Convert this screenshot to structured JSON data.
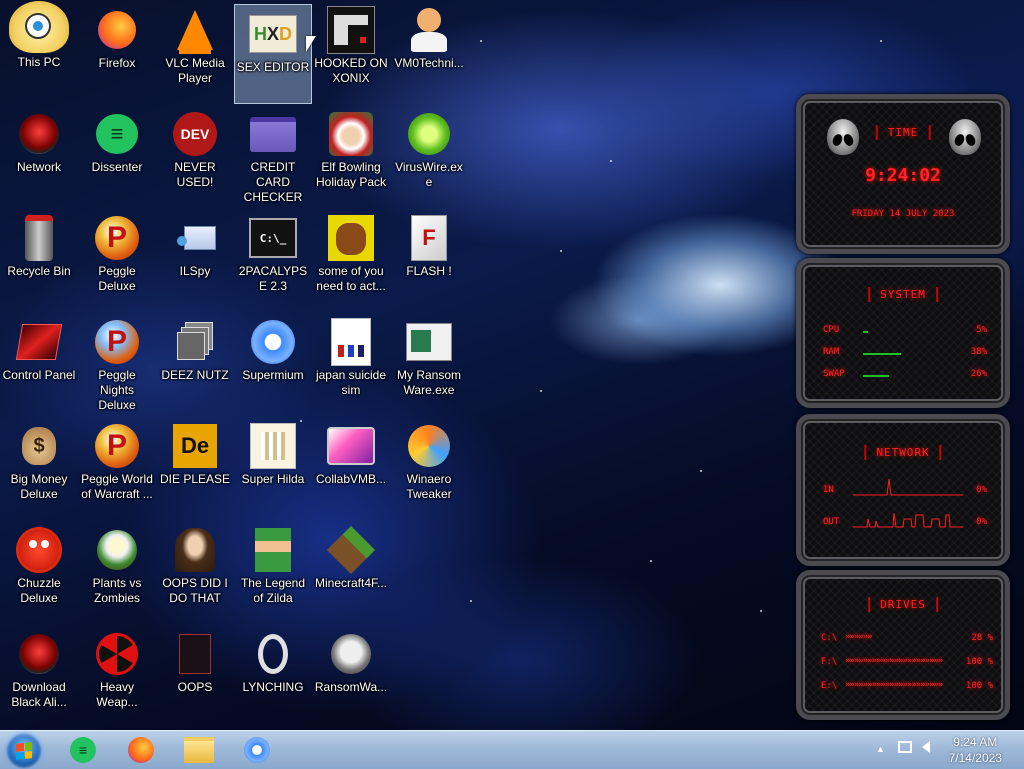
{
  "desktop": {
    "icons": [
      {
        "label": "This PC"
      },
      {
        "label": "Firefox"
      },
      {
        "label": "VLC Media Player"
      },
      {
        "label": "SEX EDITOR"
      },
      {
        "label": "HOOKED ON XONIX"
      },
      {
        "label": "VM0Techni..."
      },
      {
        "label": "Network"
      },
      {
        "label": "Dissenter"
      },
      {
        "label": "NEVER USED!"
      },
      {
        "label": "CREDIT CARD CHECKER"
      },
      {
        "label": "Elf Bowling Holiday Pack"
      },
      {
        "label": "VirusWire.exe"
      },
      {
        "label": "Recycle Bin"
      },
      {
        "label": "Peggle Deluxe"
      },
      {
        "label": "ILSpy"
      },
      {
        "label": "2PACALYPSE 2.3"
      },
      {
        "label": "some of you need to act..."
      },
      {
        "label": "FLASH !"
      },
      {
        "label": "Control Panel"
      },
      {
        "label": "Peggle Nights Deluxe"
      },
      {
        "label": "DEEZ NUTZ"
      },
      {
        "label": "Supermium"
      },
      {
        "label": "japan suicide sim"
      },
      {
        "label": "My Ransom Ware.exe"
      },
      {
        "label": "Big Money Deluxe"
      },
      {
        "label": "Peggle World of Warcraft ..."
      },
      {
        "label": "DIE PLEASE"
      },
      {
        "label": "Super Hilda"
      },
      {
        "label": "CollabVMB..."
      },
      {
        "label": "Winaero Tweaker"
      },
      {
        "label": "Chuzzle Deluxe"
      },
      {
        "label": "Plants vs Zombies"
      },
      {
        "label": "OOPS DID I DO THAT"
      },
      {
        "label": "The Legend of Zilda"
      },
      {
        "label": "Minecraft4F..."
      },
      {
        "label": "Download Black Ali..."
      },
      {
        "label": "Heavy Weap..."
      },
      {
        "label": "OOPS"
      },
      {
        "label": "LYNCHING"
      },
      {
        "label": "RansomWa..."
      }
    ],
    "icon_glyphs": {
      "vlc": "▲",
      "dev": "DEV",
      "dissenter": "≡",
      "cmd": "C:\\_",
      "de": "De",
      "flash": "F",
      "peggle": "P"
    }
  },
  "widgets": {
    "time": {
      "title": "TIME",
      "clock": "9:24:02",
      "date": "FRIDAY 14 JULY 2023"
    },
    "system": {
      "title": "SYSTEM",
      "rows": [
        {
          "label": "CPU",
          "value": "5%",
          "level": 0.05
        },
        {
          "label": "RAM",
          "value": "38%",
          "level": 0.38
        },
        {
          "label": "SWAP",
          "value": "26%",
          "level": 0.26
        }
      ]
    },
    "network": {
      "title": "NETWORK",
      "rows": [
        {
          "label": "IN",
          "value": "0%"
        },
        {
          "label": "OUT",
          "value": "0%"
        }
      ]
    },
    "drives": {
      "title": "DRIVES",
      "rows": [
        {
          "label": "C:\\",
          "value": "28 %",
          "level": 0.28
        },
        {
          "label": "F:\\",
          "value": "100 %",
          "level": 1.0
        },
        {
          "label": "E:\\",
          "value": "100 %",
          "level": 1.0
        }
      ]
    }
  },
  "taskbar": {
    "time": "9:24 AM",
    "date": "7/14/2023",
    "tray_arrow": "▲"
  },
  "colors": {
    "widget_red": "#ff2222",
    "taskbar": "#9fb9d8",
    "selection": "#aac3e1"
  }
}
